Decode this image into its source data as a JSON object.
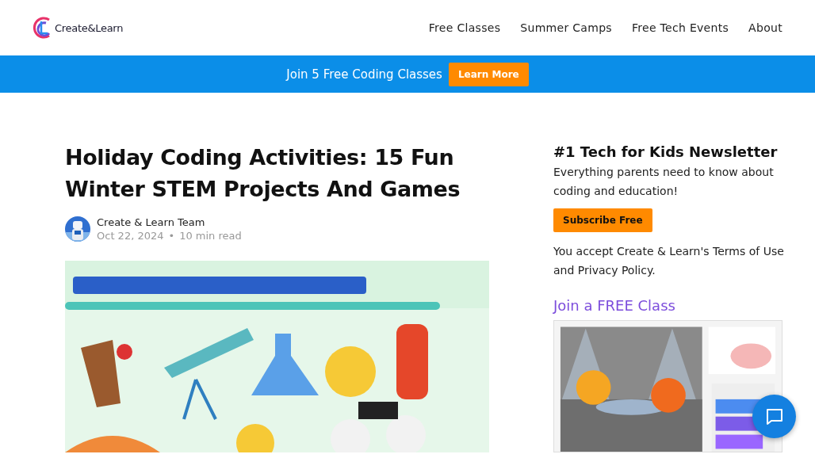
{
  "header": {
    "logo": "Create&Learn",
    "nav": [
      {
        "label": "Free Classes"
      },
      {
        "label": "Summer Camps"
      },
      {
        "label": "Free Tech Events"
      },
      {
        "label": "About"
      }
    ]
  },
  "banner": {
    "text": "Join 5 Free Coding Classes",
    "button": "Learn More"
  },
  "article": {
    "title": "Holiday Coding Activities: 15 Fun Winter STEM Projects And Games",
    "author": "Create & Learn Team",
    "date": "Oct 22, 2024",
    "separator": "•",
    "read_time": "10 min read"
  },
  "sidebar": {
    "heading": "#1 Tech for Kids Newsletter",
    "text": "Everything parents need to know about coding and education!",
    "button": "Subscribe Free",
    "legal": "You accept Create & Learn's Terms of Use and Privacy Policy.",
    "class_heading": "Join a FREE Class"
  }
}
